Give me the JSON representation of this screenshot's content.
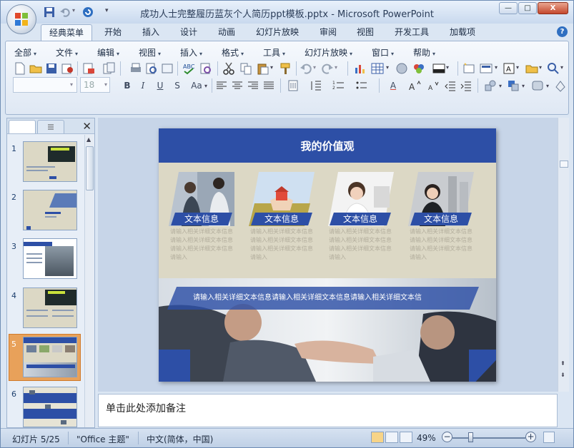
{
  "window": {
    "title": "成功人士完整履历蓝灰个人简历ppt模板.pptx - Microsoft PowerPoint",
    "controls": {
      "minimize": "—",
      "maximize": "□",
      "close": "X"
    }
  },
  "ribbon_tabs": [
    {
      "label": "经典菜单",
      "active": true
    },
    {
      "label": "开始"
    },
    {
      "label": "插入"
    },
    {
      "label": "设计"
    },
    {
      "label": "动画"
    },
    {
      "label": "幻灯片放映"
    },
    {
      "label": "审阅"
    },
    {
      "label": "视图"
    },
    {
      "label": "开发工具"
    },
    {
      "label": "加载项"
    }
  ],
  "classic_menus": [
    {
      "label": "全部"
    },
    {
      "label": "文件"
    },
    {
      "label": "编辑"
    },
    {
      "label": "视图"
    },
    {
      "label": "插入"
    },
    {
      "label": "格式"
    },
    {
      "label": "工具"
    },
    {
      "label": "幻灯片放映"
    },
    {
      "label": "窗口"
    },
    {
      "label": "帮助"
    }
  ],
  "font_size": "18",
  "format_buttons": {
    "bold": "B",
    "italic": "I",
    "underline": "U",
    "strike": "S",
    "case": "Aa",
    "font_color": "A"
  },
  "slide_numbers": [
    "1",
    "2",
    "3",
    "4",
    "5",
    "6"
  ],
  "selected_slide": "5",
  "slide": {
    "title": "我的价值观",
    "cards": [
      {
        "label": "文本信息",
        "desc": "请输入相关详细文本信息请输入相关详细文本信息请输入相关详细文本信息请输入"
      },
      {
        "label": "文本信息",
        "desc": "请输入相关详细文本信息请输入相关详细文本信息请输入相关详细文本信息请输入"
      },
      {
        "label": "文本信息",
        "desc": "请输入相关详细文本信息请输入相关详细文本信息请输入相关详细文本信息请输入"
      },
      {
        "label": "文本信息",
        "desc": "请输入相关详细文本信息请输入相关详细文本信息请输入相关详细文本信息请输入"
      }
    ],
    "banner_text": "请输入相关详细文本信息请输入相关详细文本信息请输入相关详细文本信"
  },
  "notes_placeholder": "单击此处添加备注",
  "status": {
    "slide_info": "幻灯片 5/25",
    "theme": "\"Office 主题\"",
    "language": "中文(简体，中国)",
    "zoom": "49%"
  },
  "colors": {
    "accent": "#2d4fa6",
    "slide_bg": "#dcd8c5",
    "selection": "#e8a15a"
  }
}
